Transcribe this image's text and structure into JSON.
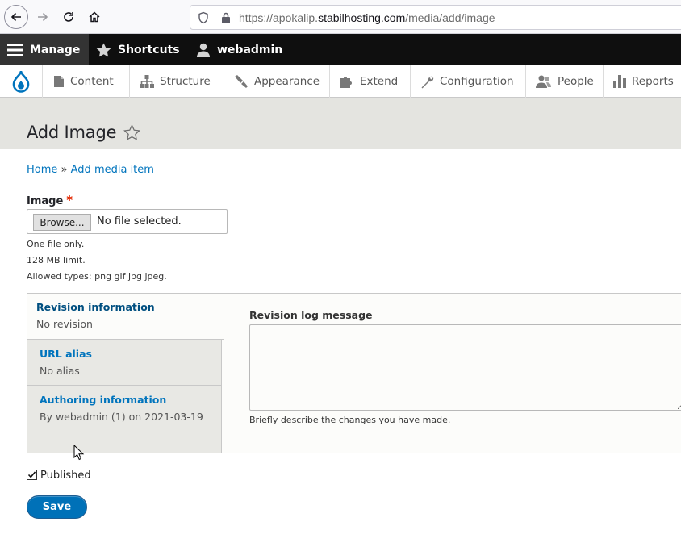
{
  "browser": {
    "url_prefix": "https://apokalip.",
    "url_domain": "stabilhosting.com",
    "url_path": "/media/add/image"
  },
  "toolbar": {
    "manage": "Manage",
    "shortcuts": "Shortcuts",
    "user": "webadmin"
  },
  "tray": {
    "items": [
      {
        "label": "Content",
        "icon": "file-icon"
      },
      {
        "label": "Structure",
        "icon": "structure-icon"
      },
      {
        "label": "Appearance",
        "icon": "paintbrush-icon"
      },
      {
        "label": "Extend",
        "icon": "puzzle-icon"
      },
      {
        "label": "Configuration",
        "icon": "wrench-icon"
      },
      {
        "label": "People",
        "icon": "people-icon"
      },
      {
        "label": "Reports",
        "icon": "bar-chart-icon"
      }
    ]
  },
  "page": {
    "title": "Add Image"
  },
  "breadcrumb": {
    "home": "Home",
    "separator": "»",
    "current": "Add media item"
  },
  "image_field": {
    "label": "Image",
    "required_mark": "*",
    "browse_label": "Browse...",
    "no_file_text": "No file selected.",
    "help": [
      "One file only.",
      "128 MB limit.",
      "Allowed types: png gif jpg jpeg."
    ]
  },
  "vertical_tabs": {
    "tabs": [
      {
        "title": "Revision information",
        "summary": "No revision"
      },
      {
        "title": "URL alias",
        "summary": "No alias"
      },
      {
        "title": "Authoring information",
        "summary": "By webadmin (1) on 2021-03-19"
      }
    ],
    "pane": {
      "label": "Revision log message",
      "value": "",
      "help": "Briefly describe the changes you have made."
    }
  },
  "published": {
    "label": "Published",
    "checked": true
  },
  "actions": {
    "save": "Save"
  },
  "colors": {
    "link": "#0074bd",
    "primary_button": "#0071b8",
    "toolbar_bg": "#0f0f0f",
    "header_bg": "#e4e4e0"
  }
}
